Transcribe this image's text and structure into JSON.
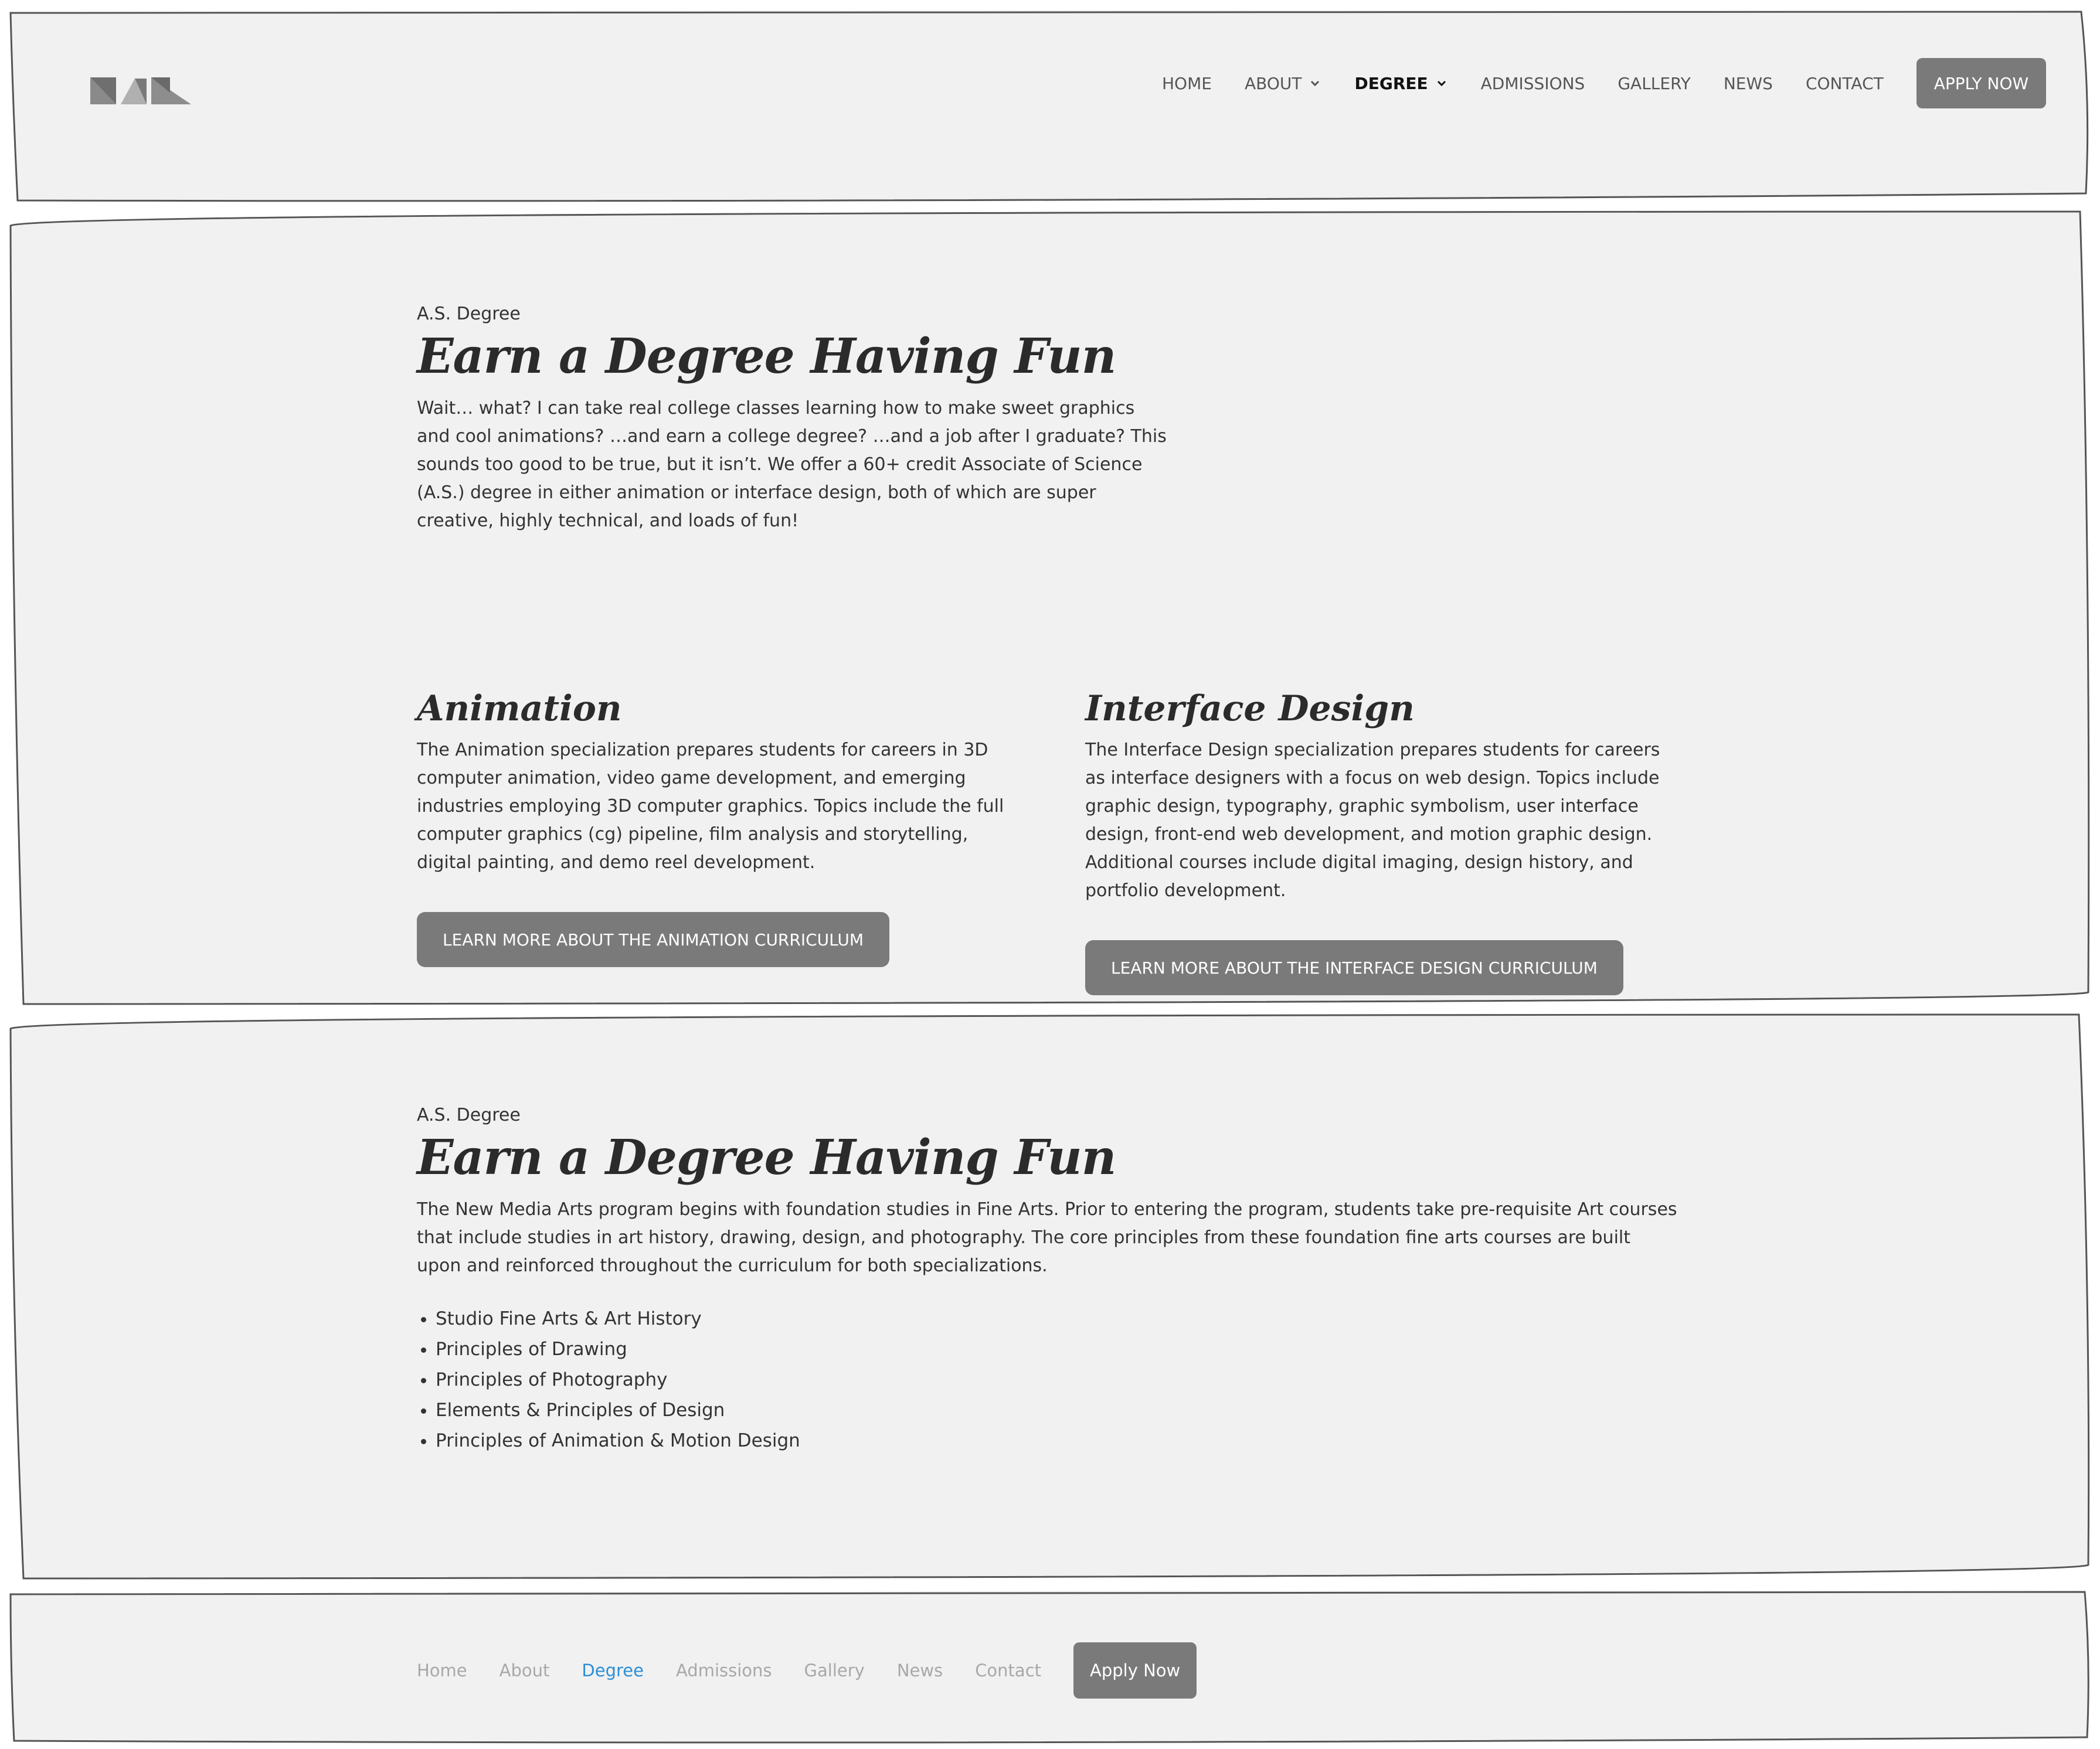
{
  "colors": {
    "panel_bg": "#f1f1f1",
    "panel_border": "#555555",
    "button_bg": "#7a7a7a",
    "active_link": "#2a8fd6"
  },
  "header": {
    "logo": "NMA logo (geometric triangles)",
    "nav": {
      "home": "HOME",
      "about": "ABOUT",
      "degree": "DEGREE",
      "admissions": "ADMISSIONS",
      "gallery": "GALLERY",
      "news": "NEWS",
      "contact": "CONTACT"
    },
    "apply_label": "APPLY NOW"
  },
  "section1": {
    "eyebrow": "A.S. Degree",
    "title": "Earn a Degree Having Fun",
    "intro": "Wait… what? I can take real college classes learning how to make sweet graphics and cool animations? …and earn a college degree? …and a job after I graduate? This sounds too good to be true, but it isn’t. We offer a 60+ credit Associate of Science (A.S.) degree in either animation or interface design, both of which are super creative, highly technical, and loads of fun!",
    "animation": {
      "title": "Animation",
      "body": "The Animation specialization prepares students for careers in 3D computer animation, video game development, and emerging industries employing 3D computer graphics. Topics include the full computer graphics (cg) pipeline, film analysis and storytelling, digital painting, and demo reel development.",
      "cta": "LEARN MORE ABOUT THE ANIMATION CURRICULUM"
    },
    "interface": {
      "title": "Interface Design",
      "body": "The Interface Design specialization prepares students for careers as interface designers with a focus on web design. Topics include graphic design, typography, graphic symbolism, user interface design, front-end web development, and motion graphic design. Additional courses include digital imaging, design history, and portfolio development.",
      "cta": "LEARN MORE ABOUT THE INTERFACE DESIGN CURRICULUM"
    }
  },
  "section2": {
    "eyebrow": "A.S. Degree",
    "title": "Earn a Degree Having Fun",
    "body": "The New Media Arts program begins with foundation studies in Fine Arts. Prior to entering the program, students take pre-requisite Art courses that include studies in art history, drawing, design, and photography. The core principles from these foundation fine arts courses are built upon and reinforced throughout the curriculum for both specializations.",
    "list": [
      "Studio Fine Arts & Art History",
      "Principles of Drawing",
      "Principles of Photography",
      "Elements & Principles of Design",
      "Principles of Animation & Motion Design"
    ]
  },
  "footer": {
    "nav": {
      "home": "Home",
      "about": "About",
      "degree": "Degree",
      "admissions": "Admissions",
      "gallery": "Gallery",
      "news": "News",
      "contact": "Contact"
    },
    "apply_label": "Apply Now"
  }
}
